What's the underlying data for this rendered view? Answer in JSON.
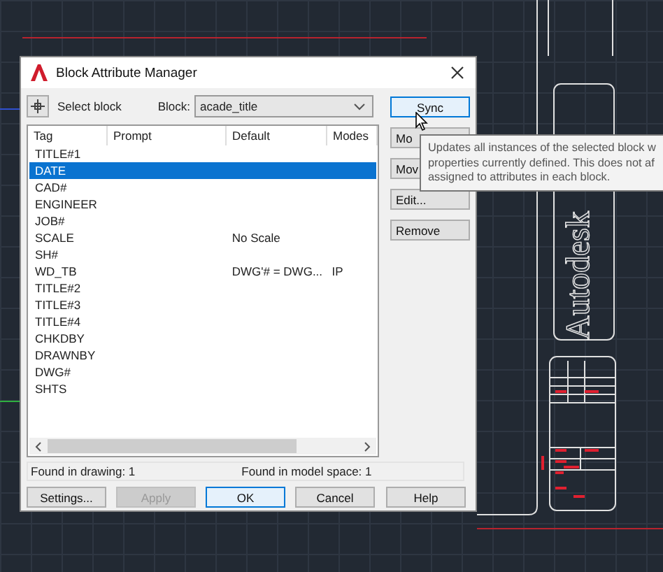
{
  "canvas": {
    "drawing_text": "Autodesk"
  },
  "dialog": {
    "title": "Block Attribute Manager",
    "select_block_label": "Select block",
    "block_label": "Block:",
    "block_value": "acade_title",
    "columns": [
      "Tag",
      "Prompt",
      "Default",
      "Modes"
    ],
    "rows": [
      {
        "tag": "TITLE#1",
        "selected": false
      },
      {
        "tag": "DATE",
        "selected": true
      },
      {
        "tag": "CAD#",
        "selected": false
      },
      {
        "tag": "ENGINEER",
        "selected": false
      },
      {
        "tag": "JOB#",
        "selected": false
      },
      {
        "tag": "SCALE",
        "default": "No Scale",
        "selected": false
      },
      {
        "tag": "SH#",
        "selected": false
      },
      {
        "tag": "WD_TB",
        "default": "DWG'# = DWG...",
        "modes": "IP",
        "selected": false
      },
      {
        "tag": "TITLE#2",
        "selected": false
      },
      {
        "tag": "TITLE#3",
        "selected": false
      },
      {
        "tag": "TITLE#4",
        "selected": false
      },
      {
        "tag": "CHKDBY",
        "selected": false
      },
      {
        "tag": "DRAWNBY",
        "selected": false
      },
      {
        "tag": "DWG#",
        "selected": false
      },
      {
        "tag": "SHTS",
        "selected": false
      }
    ],
    "status": [
      "Found in drawing: 1",
      "Found in model space: 1"
    ],
    "side_buttons": [
      {
        "label": "Sync",
        "focused": true
      },
      {
        "label": "Mo",
        "focused": false
      },
      {
        "label": "Mov",
        "focused": false
      },
      {
        "label": "Edit...",
        "focused": false
      },
      {
        "label": "Remove",
        "focused": false
      }
    ],
    "bottom_buttons": [
      {
        "label": "Settings...",
        "disabled": false,
        "focused": false
      },
      {
        "label": "Apply",
        "disabled": true,
        "focused": false
      },
      {
        "label": "OK",
        "disabled": false,
        "focused": true
      },
      {
        "label": "Cancel",
        "disabled": false,
        "focused": false
      },
      {
        "label": "Help",
        "disabled": false,
        "focused": false
      }
    ]
  },
  "tooltip": {
    "lines": [
      "Updates all instances of the selected block w",
      "properties currently defined. This does not af",
      "assigned to attributes in each block."
    ]
  }
}
